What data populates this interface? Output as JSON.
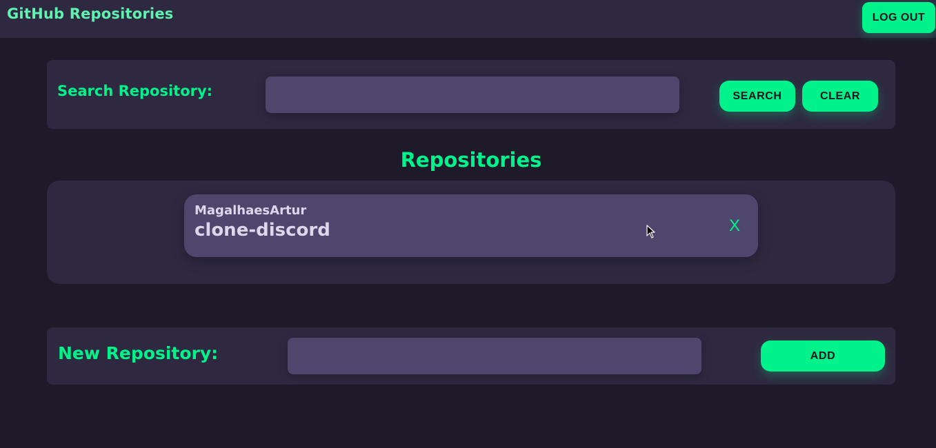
{
  "header": {
    "title": "GitHub Repositories",
    "logout_label": "LOG OUT"
  },
  "search": {
    "label": "Search Repository:",
    "value": "",
    "search_label": "SEARCH",
    "clear_label": "CLEAR"
  },
  "repositories": {
    "title": "Repositories",
    "items": [
      {
        "owner": "MagalhaesArtur",
        "name": "clone-discord",
        "remove_label": "X"
      }
    ]
  },
  "new_repository": {
    "label": "New Repository:",
    "value": "",
    "add_label": "ADD"
  },
  "colors": {
    "accent": "#00f28a",
    "background": "#1e1a2a",
    "panel": "#2e2940",
    "input": "#4f466e"
  },
  "icons": {
    "cursor": "mouse-pointer-icon"
  }
}
